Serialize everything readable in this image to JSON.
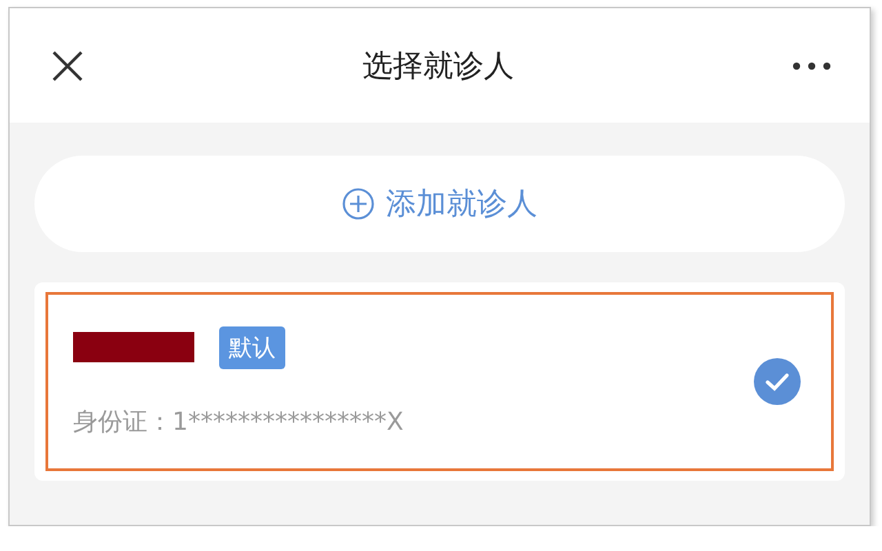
{
  "header": {
    "title": "选择就诊人"
  },
  "add_button": {
    "label": "添加就诊人"
  },
  "patients": [
    {
      "name_redacted": true,
      "tag": "默认",
      "id_text": "身份证：1****************X",
      "selected": true,
      "highlighted": true
    }
  ]
}
